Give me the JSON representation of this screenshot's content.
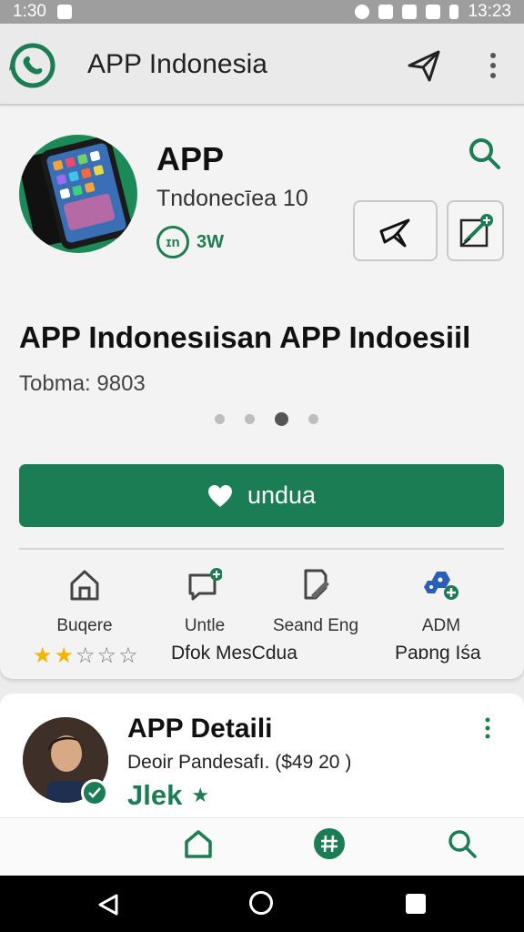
{
  "status_bar": {
    "time_left": "1:30",
    "time_right": "13:23"
  },
  "app_bar": {
    "title": "APP Indonesia",
    "icons": [
      "whatsapp-logo-icon",
      "send-icon",
      "more-vert-icon"
    ]
  },
  "app_header": {
    "name": "APP",
    "subtitle": "Tndonecīea 10",
    "badge_icon_text": "ɪn",
    "badge_count": "3W",
    "icons": [
      "search-icon",
      "pin-icon",
      "edit-add-icon"
    ]
  },
  "headline": "APP Indonesıisan APP Indoesiil",
  "meta_text": "Tobma: 9803",
  "carousel": {
    "total": 4,
    "active_index": 2
  },
  "primary_button": {
    "label": "undua",
    "icon": "heart-icon"
  },
  "features": [
    {
      "label": "Buqere",
      "icon": "home-icon"
    },
    {
      "label": "Untle",
      "icon": "chat-add-icon"
    },
    {
      "label": "Seand Eng",
      "icon": "document-edit-icon"
    },
    {
      "label": "ADM",
      "icon": "community-icon"
    }
  ],
  "rating": {
    "stars_filled": 2,
    "stars_total": 5
  },
  "captions": {
    "middle": "Dfok MesCdua",
    "right": "Paɒng Iśa"
  },
  "details_card": {
    "title": "APP Detaili",
    "subtitle": "Deoir Pandesafı. ($49 20 )",
    "tag": "Jlek"
  },
  "colors": {
    "brand_green": "#1a7d53",
    "star_gold": "#f5b400"
  }
}
